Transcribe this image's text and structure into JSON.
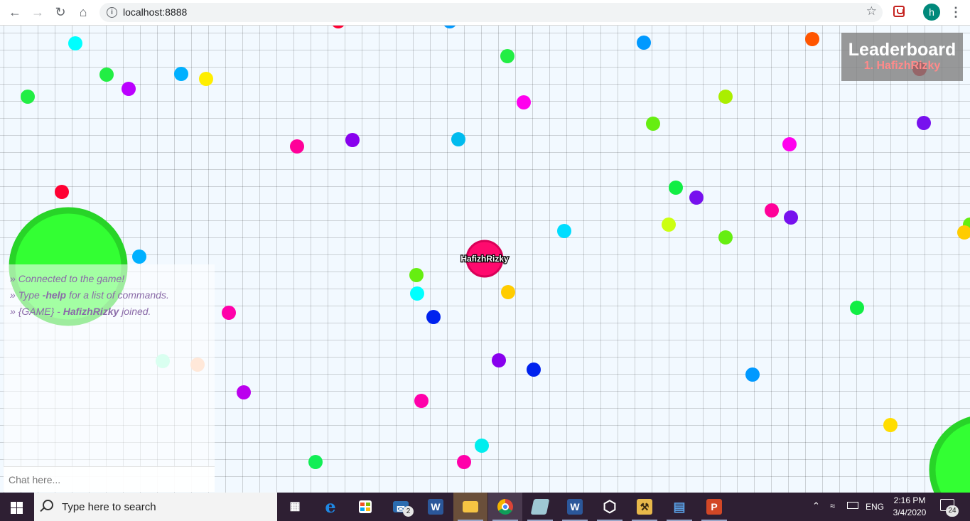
{
  "browser": {
    "url": "localhost:8888",
    "profile_initial": "h",
    "accent_color": "#00897b"
  },
  "game": {
    "player": {
      "name": "HafizhRizky",
      "color": "#ff0a6e"
    },
    "leaderboard": {
      "title": "Leaderboard",
      "entries": [
        "1. HafizhRizky"
      ]
    },
    "chat": {
      "messages": [
        {
          "prefix": "» ",
          "parts": [
            {
              "text": "Connected to the game!",
              "bold": false
            }
          ]
        },
        {
          "prefix": "» ",
          "parts": [
            {
              "text": "Type ",
              "bold": false
            },
            {
              "text": "-help",
              "bold": true
            },
            {
              "text": " for a list of commands.",
              "bold": false
            }
          ]
        },
        {
          "prefix": "» ",
          "parts": [
            {
              "text": "{GAME} - ",
              "bold": false
            },
            {
              "text": "HafizhRizky",
              "bold": true
            },
            {
              "text": " joined.",
              "bold": false
            }
          ]
        }
      ],
      "input_placeholder": "Chat here..."
    }
  },
  "taskbar": {
    "search_placeholder": "Type here to search",
    "mail_badge": "2",
    "language": "ENG",
    "time": "2:16 PM",
    "date": "3/4/2020",
    "notification_count": "24",
    "apps": [
      {
        "name": "task-view",
        "icon": "task-view-icon"
      },
      {
        "name": "edge",
        "icon": "edge-icon"
      },
      {
        "name": "store",
        "icon": "store-icon"
      },
      {
        "name": "mail",
        "icon": "mail-icon"
      },
      {
        "name": "word-taskbar",
        "icon": "word-icon"
      },
      {
        "name": "file-explorer",
        "icon": "folder-icon"
      },
      {
        "name": "chrome",
        "icon": "chrome-icon"
      },
      {
        "name": "app-notes",
        "icon": "notes-icon"
      },
      {
        "name": "word",
        "icon": "word-icon"
      },
      {
        "name": "virtualbox",
        "icon": "virtualbox-icon"
      },
      {
        "name": "app-tool",
        "icon": "tool-icon"
      },
      {
        "name": "remote",
        "icon": "remote-icon"
      },
      {
        "name": "powerpoint",
        "icon": "powerpoint-icon"
      }
    ]
  }
}
